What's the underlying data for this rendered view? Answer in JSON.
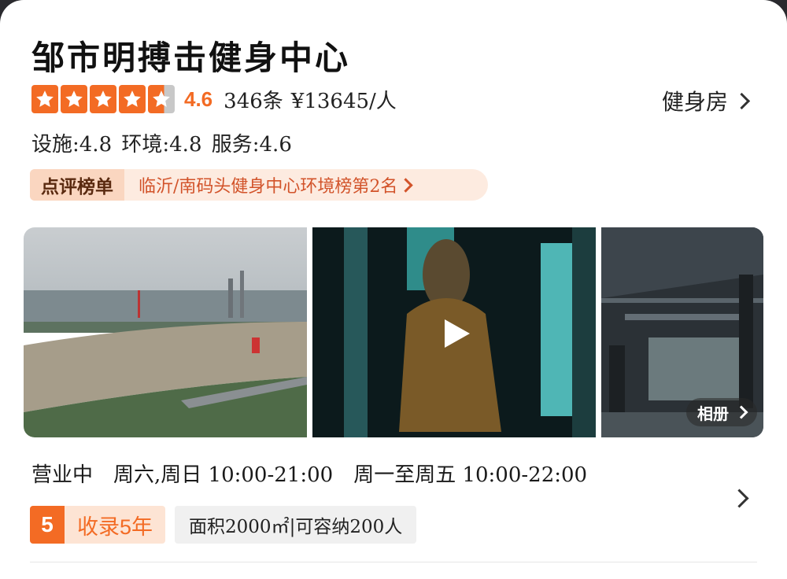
{
  "shop": {
    "name": "邹市明搏击健身中心",
    "rating": 4.6,
    "score_text": "4.6",
    "reviews": "346条",
    "price": "¥13645/人",
    "category": "健身房",
    "subratings": "设施:4.8 环境:4.8 服务:4.6"
  },
  "rank": {
    "tag": "点评榜单",
    "text": "临沂/南码头健身中心环境榜第2名"
  },
  "gallery": {
    "album_label": "相册",
    "video_icon": "play-icon"
  },
  "hours": {
    "status": "营业中",
    "weekend": "周六,周日 10:00-21:00",
    "weekday": "周一至周五 10:00-22:00"
  },
  "tags": {
    "years_num": "5",
    "years_text": "收录5年",
    "info": "面积2000㎡|可容纳200人"
  },
  "colors": {
    "accent": "#f36b24",
    "rank_text": "#d2532a"
  }
}
